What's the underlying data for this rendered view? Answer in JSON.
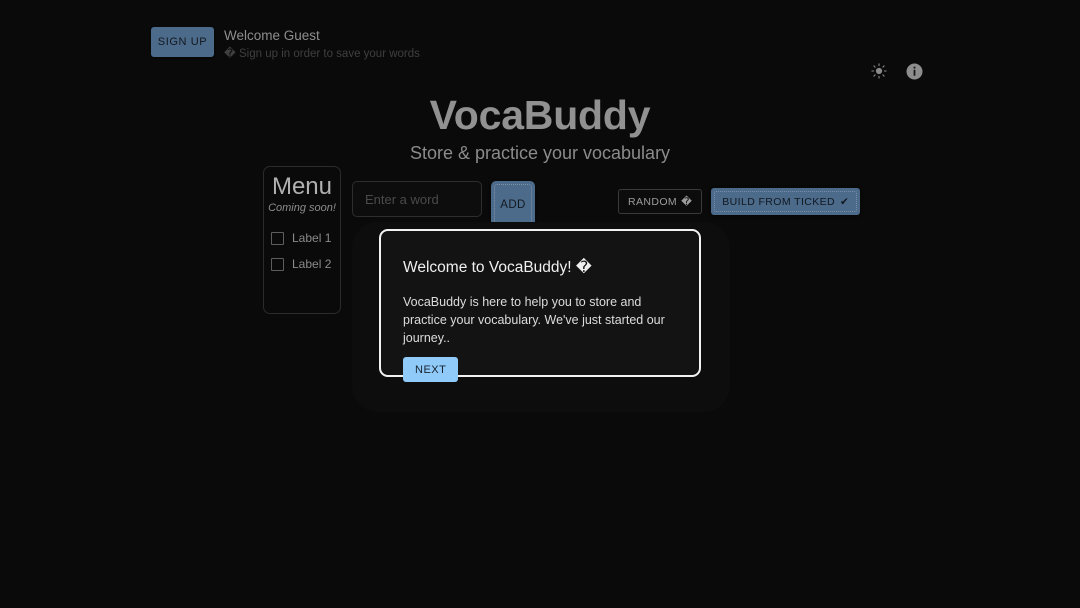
{
  "app": {
    "title": "VocaBuddy",
    "subtitle": "Store & practice your vocabulary",
    "background_color": "#0a0a0a",
    "accent_color": "#4c6a8a",
    "dialog_accent_color": "#90caf9"
  },
  "topbar": {
    "signup_label": "SIGN UP",
    "welcome_text": "Welcome Guest",
    "signup_hint_icon": "�",
    "signup_hint": "Sign up in order to save your words",
    "theme_toggle_icon": "sun-icon",
    "info_icon": "info-icon"
  },
  "menu": {
    "heading": "Menu",
    "coming_soon": "Coming soon!",
    "items": [
      {
        "label": "Label 1",
        "checked": false
      },
      {
        "label": "Label 2",
        "checked": false
      }
    ]
  },
  "word_form": {
    "input_value": "",
    "input_placeholder": "Enter a word",
    "add_label": "ADD"
  },
  "actions": {
    "random_label": "RANDOM",
    "random_icon": "�",
    "build_label": "BUILD FROM TICKED",
    "build_icon": "✔"
  },
  "dialog": {
    "title": "Welcome to VocaBuddy!",
    "title_icon": "�",
    "body": "VocaBuddy is here to help you to store and practice your vocabulary. We've just started our journey..",
    "next_label": "NEXT"
  }
}
